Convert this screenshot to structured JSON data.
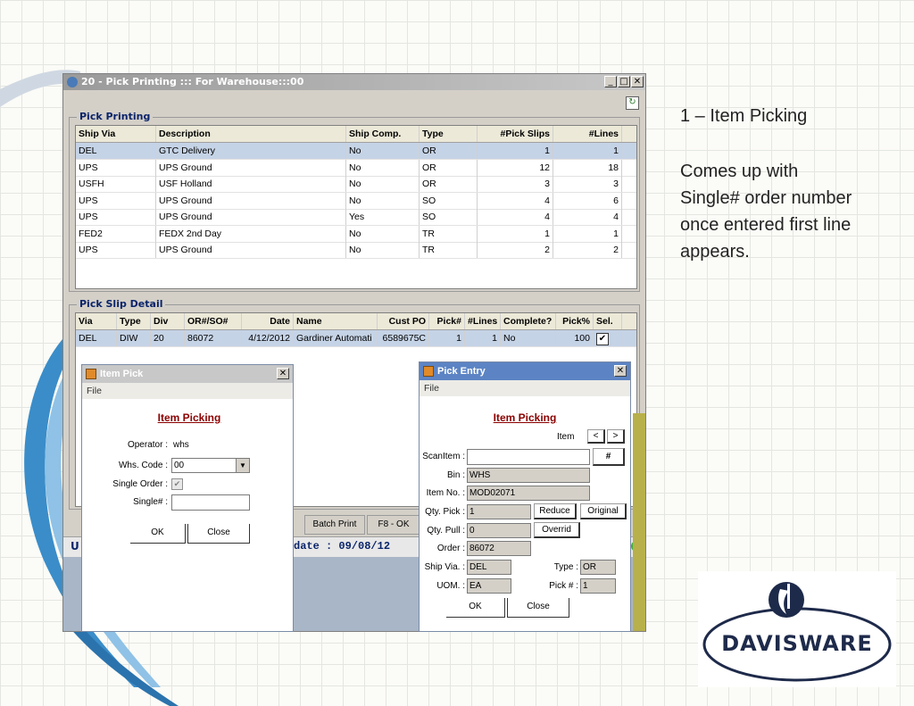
{
  "slide": {
    "title": "1 – Item Picking",
    "body": [
      "Comes up with",
      "Single# order number",
      "once entered first line",
      "appears."
    ],
    "logo_text": "DAVISWARE"
  },
  "main_window": {
    "title": "20 - Pick Printing ::: For Warehouse:::00",
    "pick_printing": {
      "label": "Pick Printing",
      "columns": [
        "Ship Via",
        "Description",
        "Ship Comp.",
        "Type",
        "#Pick Slips",
        "#Lines"
      ],
      "rows": [
        [
          "DEL",
          "GTC Delivery",
          "No",
          "OR",
          "1",
          "1"
        ],
        [
          "UPS",
          "UPS Ground",
          "No",
          "OR",
          "12",
          "18"
        ],
        [
          "USFH",
          "USF Holland",
          "No",
          "OR",
          "3",
          "3"
        ],
        [
          "UPS",
          "UPS Ground",
          "No",
          "SO",
          "4",
          "6"
        ],
        [
          "UPS",
          "UPS Ground",
          "Yes",
          "SO",
          "4",
          "4"
        ],
        [
          "FED2",
          "FEDX 2nd Day",
          "No",
          "TR",
          "1",
          "1"
        ],
        [
          "UPS",
          "UPS Ground",
          "No",
          "TR",
          "2",
          "2"
        ]
      ]
    },
    "pick_slip_detail": {
      "label": "Pick Slip Detail",
      "columns": [
        "Via",
        "Type",
        "Div",
        "OR#/SO#",
        "Date",
        "Name",
        "Cust PO",
        "Pick#",
        "#Lines",
        "Complete?",
        "Pick%",
        "Sel."
      ],
      "row": [
        "DEL",
        "DIW",
        "20",
        "86072",
        "4/12/2012",
        "Gardiner Automati",
        "6589675C",
        "1",
        "1",
        "No",
        "100",
        "✔"
      ]
    },
    "batch_print_label": "Batch Print",
    "f8_label": "F8 - OK",
    "status_left": "U",
    "status_date": "date : 09/08/12"
  },
  "item_pick": {
    "title": "Item Pick",
    "menu_file": "File",
    "heading": "Item Picking",
    "operator_label": "Operator :",
    "operator_value": "whs",
    "whs_code_label": "Whs. Code :",
    "whs_code_value": "00",
    "single_order_label": "Single Order :",
    "single_order_mark": "✔",
    "single_num_label": "Single# :",
    "single_num_value": "",
    "ok_label": "OK",
    "close_label": "Close",
    "close_x": "✕"
  },
  "pick_entry": {
    "title": "Pick Entry",
    "menu_file": "File",
    "heading": "Item Picking",
    "item_label": "Item",
    "prev_label": "<",
    "next_label": ">",
    "hash_label": "#",
    "scan_item_label": "ScanItem :",
    "scan_item_value": "",
    "bin_label": "Bin :",
    "bin_value": "WHS",
    "item_no_label": "Item No. :",
    "item_no_value": "MOD02071",
    "qty_pick_label": "Qty. Pick :",
    "qty_pick_value": "1",
    "reduce_label": "Reduce",
    "original_label": "Original",
    "qty_pull_label": "Qty. Pull :",
    "qty_pull_value": "0",
    "override_label": "Overrid",
    "order_label": "Order :",
    "order_value": "86072",
    "ship_via_label": "Ship Via. :",
    "ship_via_value": "DEL",
    "type_label": "Type :",
    "type_value": "OR",
    "uom_label": "UOM. :",
    "uom_value": "EA",
    "pick_num_label": "Pick # :",
    "pick_num_value": "1",
    "ok_label": "OK",
    "close_label": "Close",
    "close_x": "✕"
  },
  "colors": {
    "dialog_title": "#5c84c4",
    "heading": "#8b0000",
    "selected_row": "#c5d3e6",
    "logo_navy": "#1e2a4a"
  }
}
